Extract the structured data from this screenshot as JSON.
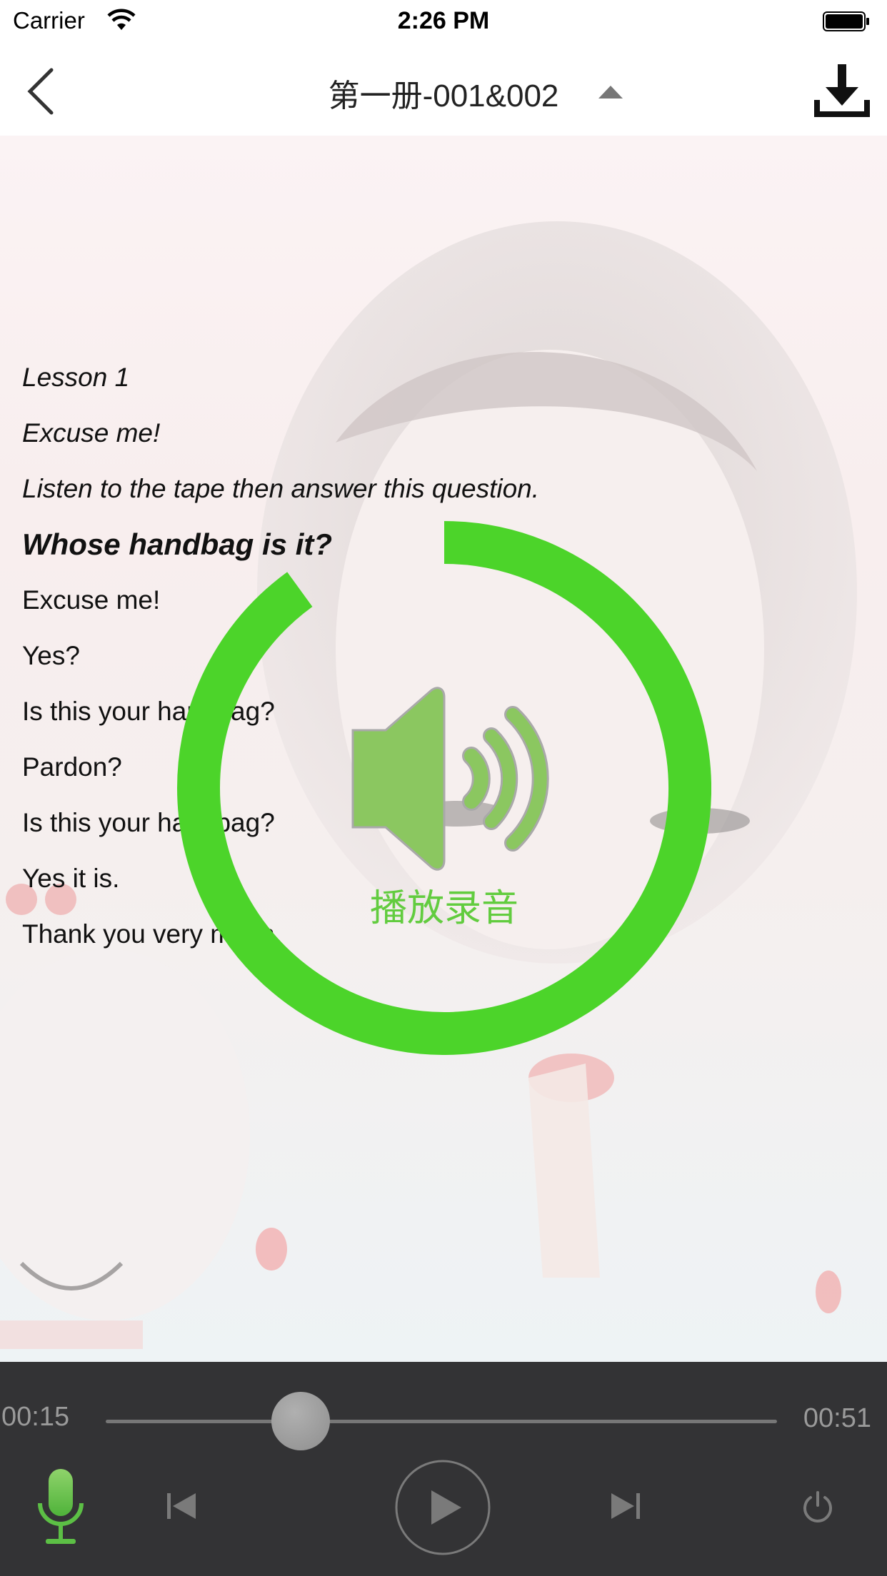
{
  "status_bar": {
    "carrier": "Carrier",
    "time": "2:26 PM"
  },
  "nav": {
    "title": "第一册-001&002"
  },
  "lesson": {
    "lines": [
      "Lesson 1",
      "Excuse me!",
      "Listen to the tape then answer this question.",
      "Whose handbag is it?",
      "Excuse me!",
      "Yes?",
      "Is this your handbag?",
      "Pardon?",
      "Is this your handbag?",
      "Yes it is.",
      "Thank you very much."
    ]
  },
  "overlay": {
    "label": "播放录音",
    "progress": 0.9,
    "accent_color": "#4cd42a"
  },
  "player": {
    "current_time": "00:15",
    "total_time": "00:51",
    "progress": 0.29
  },
  "icons": [
    "wifi-icon",
    "battery-icon",
    "back-chevron-icon",
    "dropdown-triangle-icon",
    "download-icon",
    "speaker-icon",
    "microphone-icon",
    "previous-track-icon",
    "play-icon",
    "next-track-icon",
    "power-icon"
  ]
}
